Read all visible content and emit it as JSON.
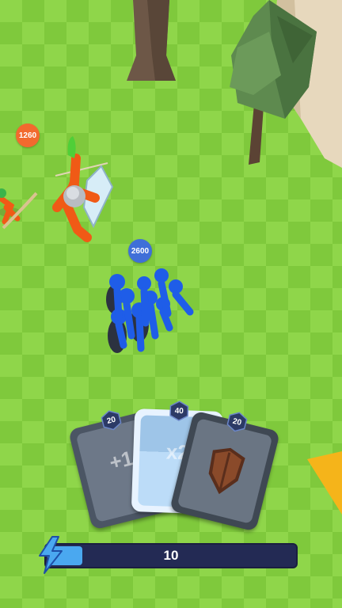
{
  "enemy": {
    "power": "1260",
    "color": "#f26a2e"
  },
  "player": {
    "power": "2600",
    "color": "#3f6fd8"
  },
  "cards": [
    {
      "cost": "20",
      "multiplier": "+1"
    },
    {
      "cost": "40",
      "multiplier": "x2"
    },
    {
      "cost": "20",
      "icon": "wooden-shield-icon"
    }
  ],
  "energy": {
    "value": "10",
    "fill_fraction": 0.14,
    "icon": "lightning-icon"
  }
}
